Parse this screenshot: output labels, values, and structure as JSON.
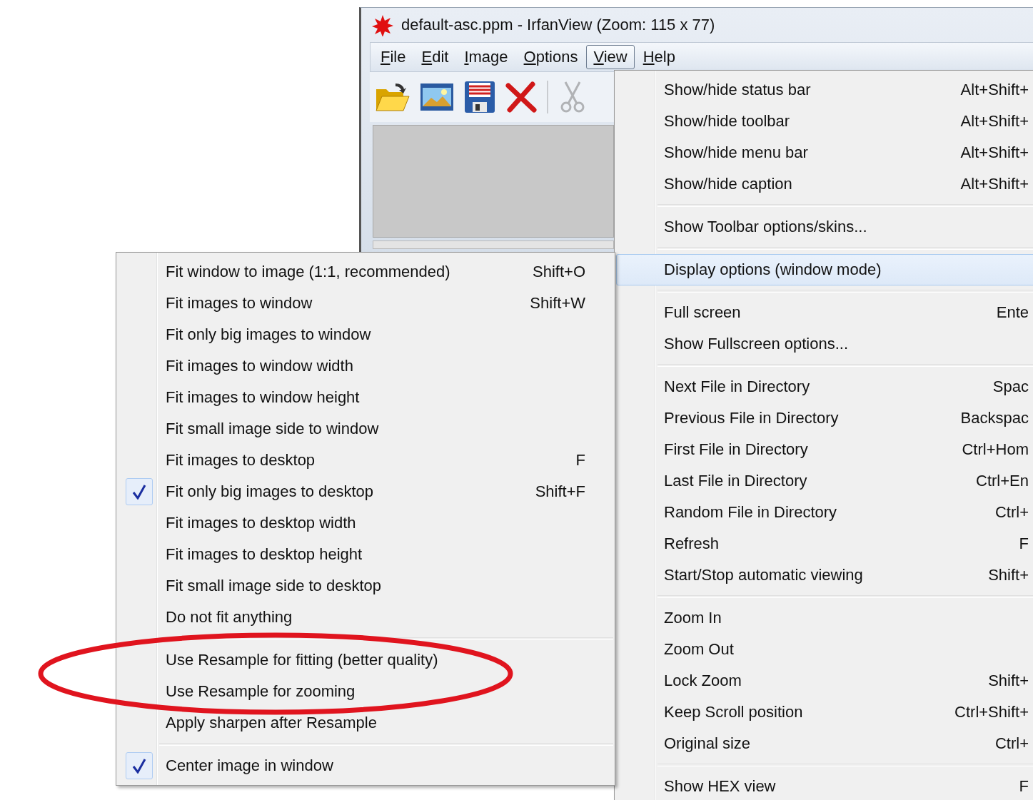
{
  "window": {
    "title": "default-asc.ppm - IrfanView (Zoom: 115 x 77)"
  },
  "menu_bar": [
    {
      "label": "File",
      "selected": false
    },
    {
      "label": "Edit",
      "selected": false
    },
    {
      "label": "Image",
      "selected": false
    },
    {
      "label": "Options",
      "selected": false
    },
    {
      "label": "View",
      "selected": true
    },
    {
      "label": "Help",
      "selected": false
    }
  ],
  "toolbar": [
    {
      "kind": "open"
    },
    {
      "kind": "slideshow"
    },
    {
      "kind": "save"
    },
    {
      "kind": "delete"
    },
    {
      "kind": "separator"
    },
    {
      "kind": "cut",
      "disabled": true
    }
  ],
  "view_menu": {
    "groups": [
      [
        {
          "label": "Show/hide status bar",
          "shortcut": "Alt+Shift+",
          "highlighted": false
        },
        {
          "label": "Show/hide toolbar",
          "shortcut": "Alt+Shift+",
          "highlighted": false
        },
        {
          "label": "Show/hide menu bar",
          "shortcut": "Alt+Shift+",
          "highlighted": false
        },
        {
          "label": "Show/hide caption",
          "shortcut": "Alt+Shift+",
          "highlighted": false
        }
      ],
      [
        {
          "label": "Show Toolbar options/skins...",
          "highlighted": false
        }
      ],
      [
        {
          "label": "Display options (window mode)",
          "highlighted": true
        }
      ],
      [
        {
          "label": "Full screen",
          "shortcut": "Ente",
          "highlighted": false
        },
        {
          "label": "Show Fullscreen options...",
          "highlighted": false
        }
      ],
      [
        {
          "label": "Next File in Directory",
          "shortcut": "Spac",
          "highlighted": false
        },
        {
          "label": "Previous File in Directory",
          "shortcut": "Backspac",
          "highlighted": false
        },
        {
          "label": "First File in Directory",
          "shortcut": "Ctrl+Hom",
          "highlighted": false
        },
        {
          "label": "Last File in Directory",
          "shortcut": "Ctrl+En",
          "highlighted": false
        },
        {
          "label": "Random File in Directory",
          "shortcut": "Ctrl+",
          "highlighted": false
        },
        {
          "label": "Refresh",
          "shortcut": "F",
          "highlighted": false
        },
        {
          "label": "Start/Stop automatic viewing",
          "shortcut": "Shift+",
          "highlighted": false
        }
      ],
      [
        {
          "label": "Zoom In",
          "highlighted": false
        },
        {
          "label": "Zoom Out",
          "highlighted": false
        },
        {
          "label": "Lock Zoom",
          "shortcut": "Shift+",
          "highlighted": false
        },
        {
          "label": "Keep Scroll position",
          "shortcut": "Ctrl+Shift+",
          "highlighted": false
        },
        {
          "label": "Original size",
          "shortcut": "Ctrl+",
          "highlighted": false
        }
      ],
      [
        {
          "label": "Show HEX view",
          "shortcut": "F",
          "highlighted": false
        }
      ]
    ]
  },
  "display_options_menu": {
    "groups": [
      [
        {
          "label": "Fit window to image (1:1, recommended)",
          "shortcut": "Shift+O",
          "checked": false
        },
        {
          "label": "Fit images to window",
          "shortcut": "Shift+W",
          "checked": false
        },
        {
          "label": "Fit only big images to window",
          "checked": false
        },
        {
          "label": "Fit images to window width",
          "checked": false
        },
        {
          "label": "Fit images to window height",
          "checked": false
        },
        {
          "label": "Fit small image side to window",
          "checked": false
        },
        {
          "label": "Fit images to desktop",
          "shortcut": "F",
          "checked": false
        },
        {
          "label": "Fit only big images to desktop",
          "shortcut": "Shift+F",
          "checked": true
        },
        {
          "label": "Fit images to desktop width",
          "checked": false
        },
        {
          "label": "Fit images to desktop height",
          "checked": false
        },
        {
          "label": "Fit small image side to desktop",
          "checked": false
        },
        {
          "label": "Do not fit anything",
          "checked": false
        }
      ],
      [
        {
          "label": "Use Resample for fitting (better quality)",
          "checked": false
        },
        {
          "label": "Use Resample for zooming",
          "checked": false
        },
        {
          "label": "Apply sharpen after Resample",
          "checked": false
        }
      ],
      [
        {
          "label": "Center image in window",
          "checked": true
        }
      ]
    ]
  }
}
